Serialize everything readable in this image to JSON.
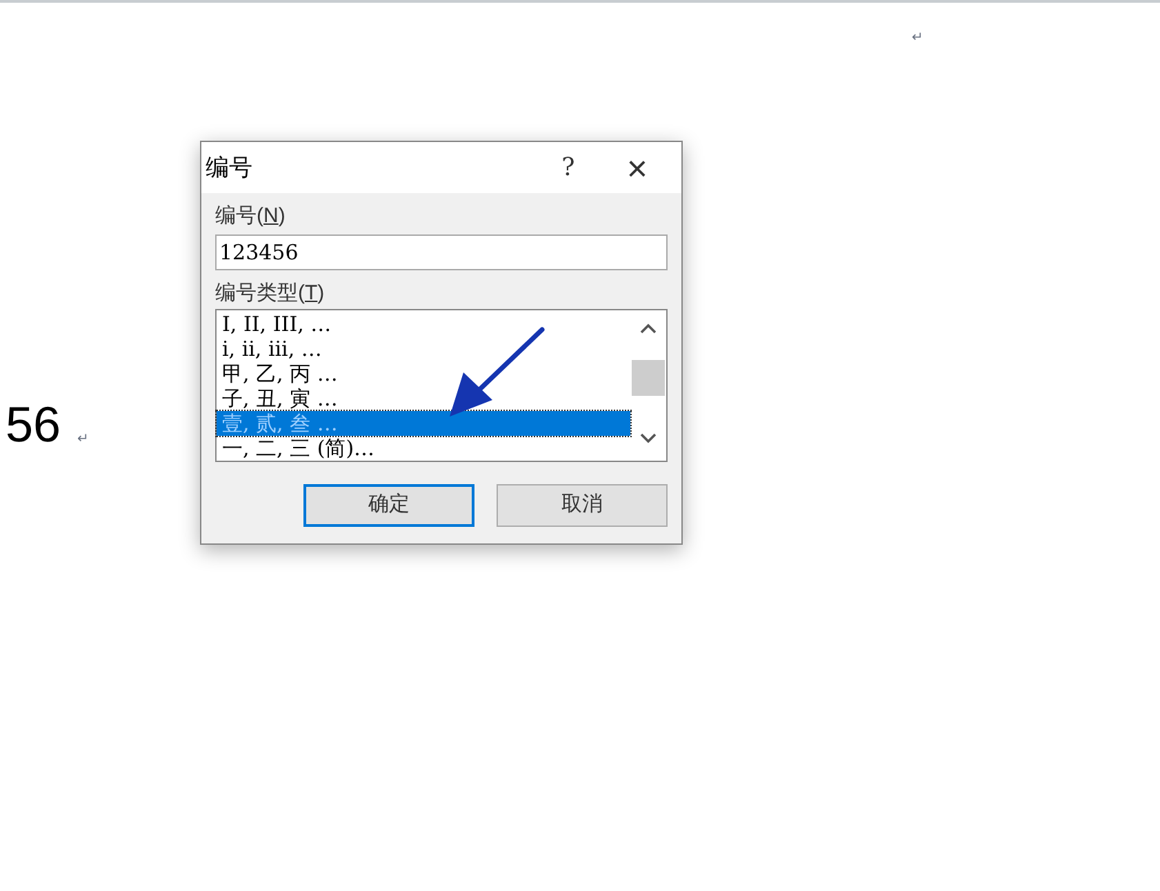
{
  "document": {
    "marks": [
      "↵",
      "↵"
    ],
    "number_text": "56"
  },
  "dialog": {
    "title": "编号",
    "help": "?",
    "close": "×",
    "number_label": "编号(**N**)",
    "number_value": "123456",
    "type_label": "编号类型(**T**)",
    "types": [
      {
        "label": "I, II, III, …",
        "selected": false
      },
      {
        "label": "i, ii, iii, …",
        "selected": false
      },
      {
        "label": "甲, 乙, 丙 …",
        "selected": false
      },
      {
        "label": "子, 丑, 寅 …",
        "selected": false
      },
      {
        "label": "壹, 贰, 叁 …",
        "selected": true
      },
      {
        "label": "一, 二, 三 (简)…",
        "selected": false
      }
    ],
    "buttons": [
      {
        "label": "确定",
        "default": true
      },
      {
        "label": "取消",
        "default": false
      }
    ]
  }
}
